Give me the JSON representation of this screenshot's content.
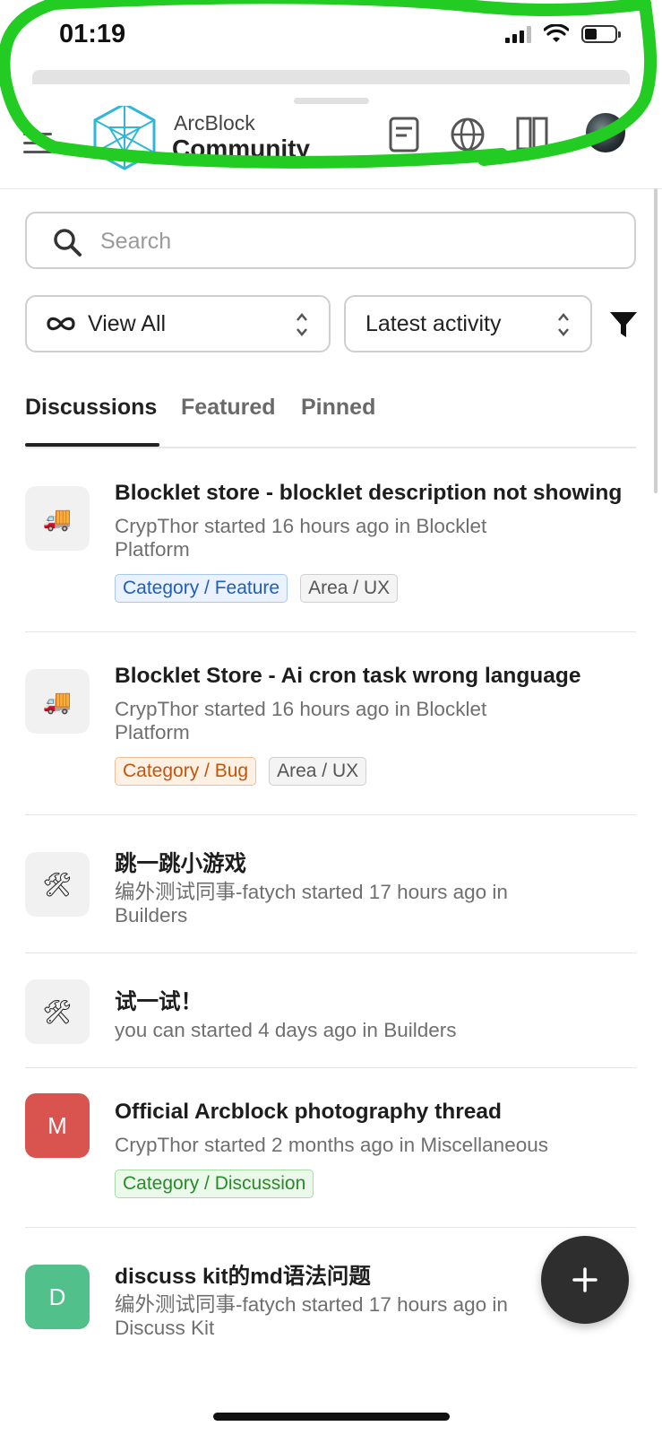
{
  "status_bar": {
    "time": "01:19"
  },
  "header": {
    "brand_line1": "ArcBlock",
    "brand_line2": "Community",
    "icons": [
      "menu-icon",
      "arcblock-logo",
      "document-icon",
      "globe-icon",
      "layout-icon",
      "user-avatar"
    ]
  },
  "search": {
    "placeholder": "Search",
    "value": ""
  },
  "filters": {
    "view": "View All",
    "sort": "Latest activity"
  },
  "tabs": [
    {
      "label": "Discussions",
      "active": true
    },
    {
      "label": "Featured",
      "active": false
    },
    {
      "label": "Pinned",
      "active": false
    }
  ],
  "discussions": [
    {
      "avatar": "🚚",
      "title": "Blocklet store - blocklet description not showing",
      "meta": "CrypThor started 16 hours ago in Blocklet Platform",
      "tags": [
        "Category / Feature",
        "Area / UX"
      ]
    },
    {
      "avatar": "🚚",
      "title": "Blocklet Store - Ai cron task wrong language",
      "meta": "CrypThor started 16 hours ago in Blocklet Platform",
      "tags": [
        "Category / Bug",
        "Area / UX"
      ]
    },
    {
      "avatar": "🛠",
      "title": "跳一跳小游戏",
      "meta": "编外测试同事-fatych started 17 hours ago in Builders",
      "tags": []
    },
    {
      "avatar": "🛠",
      "title": "试一试！",
      "meta": "you can started 4 days ago in Builders",
      "tags": []
    },
    {
      "avatar": "M",
      "title": "Official Arcblock photography thread",
      "meta": "CrypThor started 2 months ago in Miscellaneous",
      "tags": [
        "Category / Discussion"
      ]
    },
    {
      "avatar": "D",
      "title": "discuss kit的md语法问题",
      "meta": "编外测试同事-fatych started 17 hours ago in Discuss Kit",
      "tags": []
    }
  ],
  "fab": {
    "label": "+"
  },
  "colors": {
    "avatar_m": "#d9534f",
    "avatar_d": "#52c08a",
    "fab": "#2e2e2e",
    "scribble": "#22cc22"
  }
}
